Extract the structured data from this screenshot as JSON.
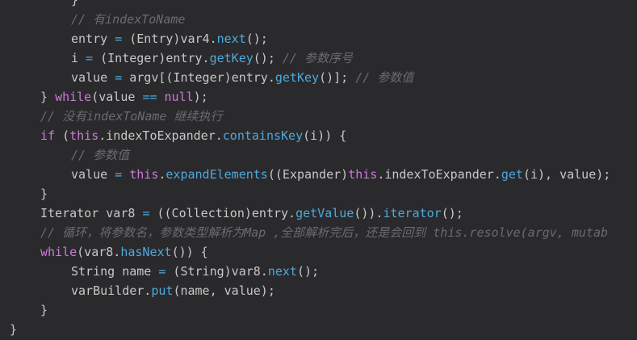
{
  "code": {
    "lines": [
      {
        "tokens": [
          {
            "t": "}",
            "c": "text"
          }
        ]
      },
      {
        "tokens": [
          {
            "t": "// 有indexToName",
            "c": "comment"
          }
        ]
      },
      {
        "tokens": [
          {
            "t": "entry ",
            "c": "text"
          },
          {
            "t": "=",
            "c": "op"
          },
          {
            "t": " (Entry)var4.",
            "c": "text"
          },
          {
            "t": "next",
            "c": "method"
          },
          {
            "t": "();",
            "c": "text"
          }
        ]
      },
      {
        "tokens": [
          {
            "t": "i ",
            "c": "text"
          },
          {
            "t": "=",
            "c": "op"
          },
          {
            "t": " (Integer)entry.",
            "c": "text"
          },
          {
            "t": "getKey",
            "c": "method"
          },
          {
            "t": "(); ",
            "c": "text"
          },
          {
            "t": "// 参数序号",
            "c": "comment"
          }
        ]
      },
      {
        "tokens": [
          {
            "t": "value ",
            "c": "text"
          },
          {
            "t": "=",
            "c": "op"
          },
          {
            "t": " argv[(Integer)entry.",
            "c": "text"
          },
          {
            "t": "getKey",
            "c": "method"
          },
          {
            "t": "()]; ",
            "c": "text"
          },
          {
            "t": "// 参数值",
            "c": "comment"
          }
        ]
      },
      {
        "tokens": [
          {
            "t": "} ",
            "c": "text"
          },
          {
            "t": "while",
            "c": "keyword"
          },
          {
            "t": "(value ",
            "c": "text"
          },
          {
            "t": "==",
            "c": "op"
          },
          {
            "t": " ",
            "c": "text"
          },
          {
            "t": "null",
            "c": "keyword"
          },
          {
            "t": ");",
            "c": "text"
          }
        ]
      },
      {
        "tokens": [
          {
            "t": "// 没有indexToName 继续执行",
            "c": "comment"
          }
        ]
      },
      {
        "tokens": [
          {
            "t": "if",
            "c": "keyword"
          },
          {
            "t": " (",
            "c": "text"
          },
          {
            "t": "this",
            "c": "keyword"
          },
          {
            "t": ".indexToExpander.",
            "c": "text"
          },
          {
            "t": "containsKey",
            "c": "method"
          },
          {
            "t": "(i)) {",
            "c": "text"
          }
        ]
      },
      {
        "tokens": [
          {
            "t": "// 参数值",
            "c": "comment"
          }
        ]
      },
      {
        "tokens": [
          {
            "t": "value ",
            "c": "text"
          },
          {
            "t": "=",
            "c": "op"
          },
          {
            "t": " ",
            "c": "text"
          },
          {
            "t": "this",
            "c": "keyword"
          },
          {
            "t": ".",
            "c": "text"
          },
          {
            "t": "expandElements",
            "c": "method"
          },
          {
            "t": "((Expander)",
            "c": "text"
          },
          {
            "t": "this",
            "c": "keyword"
          },
          {
            "t": ".indexToExpander.",
            "c": "text"
          },
          {
            "t": "get",
            "c": "method"
          },
          {
            "t": "(i), value);",
            "c": "text"
          }
        ]
      },
      {
        "tokens": [
          {
            "t": "}",
            "c": "text"
          }
        ]
      },
      {
        "tokens": [
          {
            "t": "Iterator var8 ",
            "c": "text"
          },
          {
            "t": "=",
            "c": "op"
          },
          {
            "t": " ((Collection)entry.",
            "c": "text"
          },
          {
            "t": "getValue",
            "c": "method"
          },
          {
            "t": "()).",
            "c": "text"
          },
          {
            "t": "iterator",
            "c": "method"
          },
          {
            "t": "();",
            "c": "text"
          }
        ]
      },
      {
        "tokens": [
          {
            "t": "// 循环，将参数名，参数类型解析为Map ,全部解析完后，还是会回到 this.resolve(argv, mutab",
            "c": "comment"
          }
        ]
      },
      {
        "tokens": [
          {
            "t": "while",
            "c": "keyword"
          },
          {
            "t": "(var8.",
            "c": "text"
          },
          {
            "t": "hasNext",
            "c": "method"
          },
          {
            "t": "()) {",
            "c": "text"
          }
        ]
      },
      {
        "tokens": [
          {
            "t": "String name ",
            "c": "text"
          },
          {
            "t": "=",
            "c": "op"
          },
          {
            "t": " (String)var8.",
            "c": "text"
          },
          {
            "t": "next",
            "c": "method"
          },
          {
            "t": "();",
            "c": "text"
          }
        ]
      },
      {
        "tokens": [
          {
            "t": "varBuilder.",
            "c": "text"
          },
          {
            "t": "put",
            "c": "method"
          },
          {
            "t": "(name, value);",
            "c": "text"
          }
        ]
      },
      {
        "tokens": [
          {
            "t": "}",
            "c": "text"
          }
        ]
      },
      {
        "tokens": [
          {
            "t": "}",
            "c": "text"
          }
        ]
      }
    ]
  }
}
